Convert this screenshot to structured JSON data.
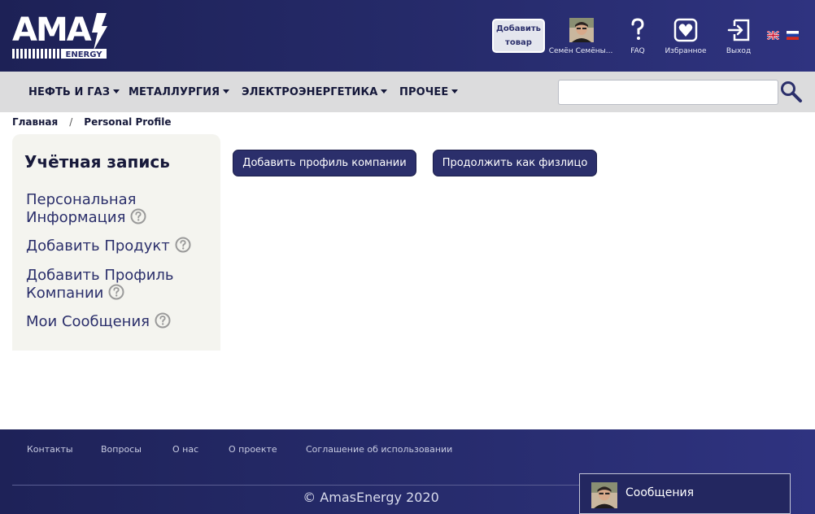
{
  "header": {
    "logo_text": "AMA",
    "logo_subtext": "ENERGY",
    "add_product_label": "Добавить товар",
    "user_name": "Семён Семёны...",
    "faq_label": "FAQ",
    "favorites_label": "Избранное",
    "logout_label": "Выход",
    "languages": [
      "en",
      "ru"
    ]
  },
  "nav": {
    "items": [
      {
        "label": "НЕФТЬ И ГАЗ"
      },
      {
        "label": "МЕТАЛЛУРГИЯ"
      },
      {
        "label": "ЭЛЕКТРОЭНЕРГЕТИКА"
      },
      {
        "label": "ПРОЧЕЕ"
      }
    ],
    "search_placeholder": "",
    "search_value": ""
  },
  "breadcrumb": {
    "home": "Главная",
    "separator": "/",
    "current": "Personal Profile"
  },
  "sidebar": {
    "title": "Учётная запись",
    "links": [
      {
        "line1": "Персональная",
        "line2": "Информация"
      },
      {
        "line1": "Добавить Продукт",
        "line2": ""
      },
      {
        "line1": "Добавить Профиль",
        "line2": "Компании"
      },
      {
        "line1": "Мои Сообщения",
        "line2": ""
      }
    ]
  },
  "main": {
    "add_company_label": "Добавить профиль компании",
    "continue_individual_label": "Продолжить как физлицо"
  },
  "footer": {
    "links": [
      {
        "label": "Контакты"
      },
      {
        "label": "Вопросы"
      },
      {
        "label": "О нас"
      },
      {
        "label": "О проекте"
      },
      {
        "label": "Соглашение об использовании"
      }
    ],
    "copyright": "© AmasEnergy 2020",
    "messages_label": "Сообщения"
  },
  "colors": {
    "brand_navy": "#2b2f6b",
    "header_bg": "#262b6b",
    "nav_bg": "#dcdcdd",
    "sidebar_bg": "#f4f4ef"
  }
}
